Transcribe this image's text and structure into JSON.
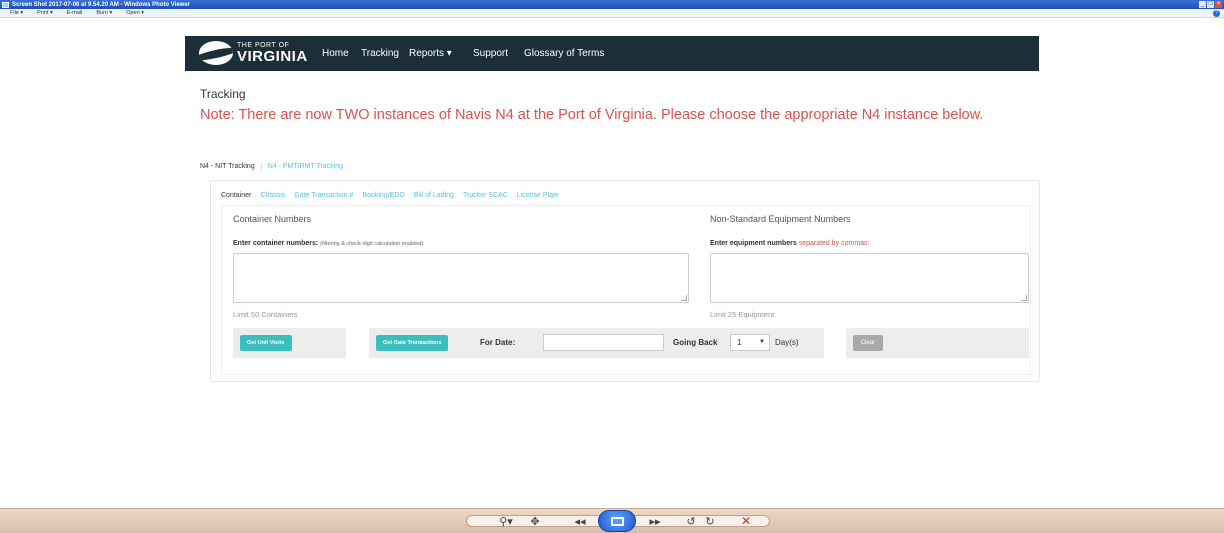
{
  "window": {
    "title": "Screen Shot 2017-07-06 at 9.54.20 AM - Windows Photo Viewer",
    "controls": [
      "_",
      "□",
      "×"
    ]
  },
  "menu": {
    "items": [
      "File ▾",
      "Print ▾",
      "E-mail",
      "Burn ▾",
      "Open ▾"
    ],
    "help_icon": "help-icon"
  },
  "site": {
    "logo_top": "THE PORT OF",
    "logo_main": "VIRGINIA",
    "nav": [
      "Home",
      "Tracking",
      "Reports ▾",
      "Support",
      "Glossary of Terms"
    ]
  },
  "page": {
    "heading": "Tracking",
    "notice": "Note: There are now TWO instances of Navis N4 at the Port of Virginia. Please choose the appropriate N4 instance below."
  },
  "outer_tabs": [
    "N4 - NIT Tracking",
    "N4 - PMT/RMT Tracking"
  ],
  "inner_tabs": [
    "Container",
    "Chassis",
    "Gate Transaction #",
    "Booking/EDO",
    "Bill of Lading",
    "Trucker SCAC",
    "License Plate"
  ],
  "container_section": {
    "title": "Container Numbers",
    "label": "Enter container numbers:",
    "hint": "(filtering & check-digit calculation enabled)",
    "value": "",
    "limit": "Limit 50 Containers"
  },
  "equipment_section": {
    "title": "Non-Standard Equipment Numbers",
    "label": "Enter equipment numbers",
    "warn": "separated by commas:",
    "value": "",
    "limit": "Limit 25 Equipment"
  },
  "actions": {
    "get_unit_visits": "Get Unit Visits",
    "get_gate_transactions": "Get Gate Transactions",
    "for_date_label": "For Date:",
    "for_date_value": "",
    "going_back_label": "Going Back",
    "going_back_value": "1",
    "days_unit": "Day(s)",
    "clear": "Clear"
  },
  "viewer_controls": {
    "zoom_icon": "zoom-icon",
    "fit_icon": "actual-size-icon",
    "slideshow_icon": "slideshow-icon",
    "rotate_ccw": "↺",
    "rotate_cw": "↻",
    "delete": "✕"
  },
  "colors": {
    "nav_bg": "#1c2e38",
    "notice_red": "#d9534f",
    "tab_link": "#5bc0de",
    "teal_button": "#3bbfbe"
  }
}
